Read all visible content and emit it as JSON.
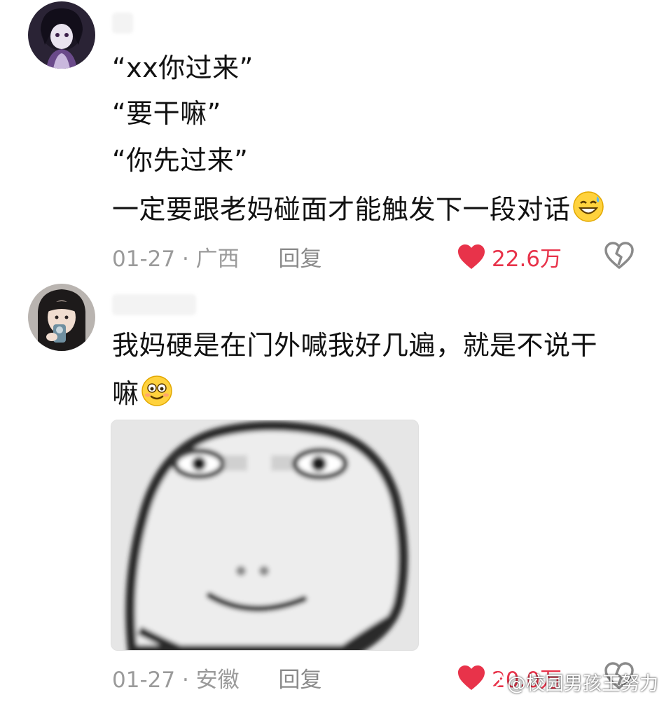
{
  "comments": [
    {
      "avatar_icon": "anime-character-avatar-icon",
      "lines": [
        "“xx你过来”",
        "“要干嘛”",
        "“你先过来”",
        "一定要跟老妈碰面才能触发下一段对话"
      ],
      "trailing_emoji": "grin-sweat-emoji",
      "date": "01-27",
      "separator": "·",
      "location": "广西",
      "reply_label": "回复",
      "like_count": "22.6万"
    },
    {
      "avatar_icon": "girl-photo-avatar-icon",
      "lines": [
        "我妈硬是在门外喊我好几遍，就是不说干",
        "嘛"
      ],
      "trailing_emoji": "awkward-smile-emoji",
      "sticker": "blurry-smiling-face-sticker",
      "date": "01-27",
      "separator": "·",
      "location": "安徽",
      "reply_label": "回复",
      "like_count": "20.0万"
    }
  ],
  "watermark": "@校园男孩王努力",
  "colors": {
    "like_red": "#e8334a",
    "meta_gray": "#9a9a9a",
    "text": "#111111"
  }
}
